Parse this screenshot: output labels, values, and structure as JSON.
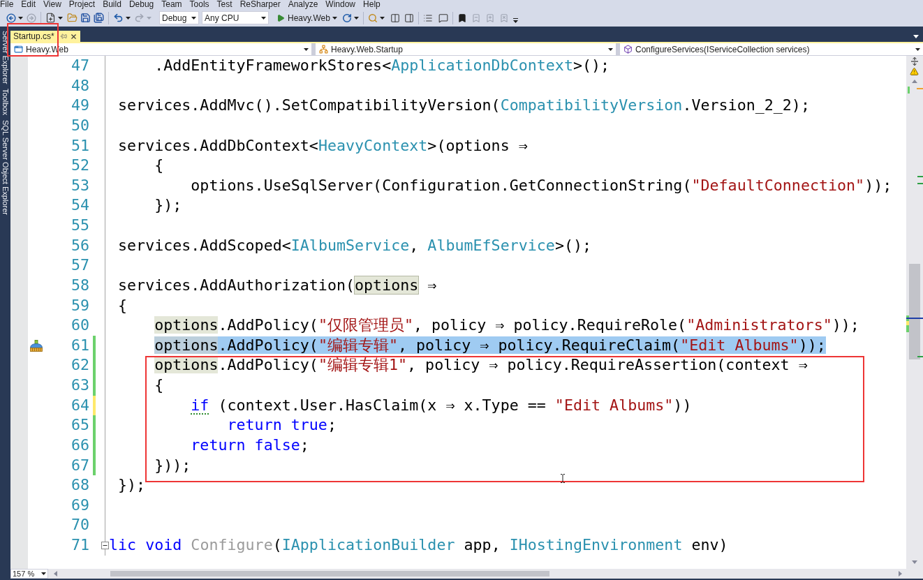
{
  "menu_bar": [
    "File",
    "Edit",
    "View",
    "Project",
    "Build",
    "Debug",
    "Team",
    "Tools",
    "Test",
    "ReSharper",
    "Analyze",
    "Window",
    "Help"
  ],
  "toolbar": {
    "configuration": "Debug",
    "platform": "Any CPU",
    "start_target": "Heavy.Web"
  },
  "side_tabs": [
    "Server Explorer",
    "Toolbox",
    "SQL Server Object Explorer"
  ],
  "document_tabs": [
    {
      "title": "Startup.cs*",
      "selected": true
    }
  ],
  "navigation_bar": [
    {
      "kind": "project",
      "text": "Heavy.Web"
    },
    {
      "kind": "class",
      "text": "Heavy.Web.Startup"
    },
    {
      "kind": "member",
      "text": "ConfigureServices(IServiceCollection services)"
    }
  ],
  "editor": {
    "lines": [
      {
        "number": "47",
        "selected": false,
        "tokens": [
          {
            "kind": "plain",
            "text": "     .AddEntityFrameworkStores<"
          },
          {
            "kind": "type",
            "text": "ApplicationDbContext"
          },
          {
            "kind": "plain",
            "text": ">();"
          }
        ]
      },
      {
        "number": "48",
        "selected": false
      },
      {
        "number": "49",
        "selected": false,
        "tokens": [
          {
            "kind": "plain",
            "text": " services.AddMvc().SetCompatibilityVersion("
          },
          {
            "kind": "type",
            "text": "CompatibilityVersion"
          },
          {
            "kind": "plain",
            "text": ".Version_2_2);"
          }
        ]
      },
      {
        "number": "50",
        "selected": false
      },
      {
        "number": "51",
        "selected": false,
        "tokens": [
          {
            "kind": "plain",
            "text": " services.AddDbContext<"
          },
          {
            "kind": "type",
            "text": "HeavyContext"
          },
          {
            "kind": "plain",
            "text": ">(options ⇒"
          }
        ]
      },
      {
        "number": "52",
        "selected": false,
        "tokens": [
          {
            "kind": "plain",
            "text": "     {"
          }
        ]
      },
      {
        "number": "53",
        "selected": false,
        "tokens": [
          {
            "kind": "plain",
            "text": "         options.UseSqlServer(Configuration.GetConnectionString("
          },
          {
            "kind": "string",
            "text": "\"DefaultConnection\""
          },
          {
            "kind": "plain",
            "text": "));"
          }
        ]
      },
      {
        "number": "54",
        "selected": false,
        "tokens": [
          {
            "kind": "plain",
            "text": "     });"
          }
        ]
      },
      {
        "number": "55",
        "selected": false
      },
      {
        "number": "56",
        "selected": false,
        "tokens": [
          {
            "kind": "plain",
            "text": " services.AddScoped<"
          },
          {
            "kind": "type",
            "text": "IAlbumService"
          },
          {
            "kind": "plain",
            "text": ", "
          },
          {
            "kind": "type",
            "text": "AlbumEfService"
          },
          {
            "kind": "plain",
            "text": ">();"
          }
        ]
      },
      {
        "number": "57",
        "selected": false
      },
      {
        "number": "58",
        "selected": false,
        "tokens": [
          {
            "kind": "plain",
            "text": " services.AddAuthorization("
          },
          {
            "kind": "definition",
            "text": "options"
          },
          {
            "kind": "plain",
            "text": " ⇒"
          }
        ]
      },
      {
        "number": "59",
        "selected": false,
        "tokens": [
          {
            "kind": "plain",
            "text": " {"
          }
        ]
      },
      {
        "number": "60",
        "selected": false,
        "tokens": [
          {
            "kind": "reference",
            "text": "     options"
          },
          {
            "kind": "plain",
            "text": ".AddPolicy("
          },
          {
            "kind": "string",
            "text": "\"仅限管理员\""
          },
          {
            "kind": "plain",
            "text": ", policy ⇒ policy.RequireRole("
          },
          {
            "kind": "string",
            "text": "\"Administrators\""
          },
          {
            "kind": "plain",
            "text": "));"
          }
        ]
      },
      {
        "number": "61",
        "selected": true,
        "change": {
          "color": "#6cd16c"
        },
        "margin_icon": {
          "kind": "cleanup"
        },
        "tokens": [
          {
            "kind": "reference",
            "text": "     options"
          },
          {
            "kind": "plain",
            "text": ".AddPolicy("
          },
          {
            "kind": "string",
            "text": "\"编辑专辑\""
          },
          {
            "kind": "plain",
            "text": ", policy ⇒ policy.RequireClaim("
          },
          {
            "kind": "string",
            "text": "\"Edit Albums\""
          },
          {
            "kind": "plain",
            "text": "));"
          }
        ]
      },
      {
        "number": "62",
        "selected": false,
        "change": {
          "color": "#6cd16c"
        },
        "tokens": [
          {
            "kind": "reference",
            "text": "     options"
          },
          {
            "kind": "plain",
            "text": ".AddPolicy("
          },
          {
            "kind": "string",
            "text": "\"编辑专辑1\""
          },
          {
            "kind": "plain",
            "text": ", policy ⇒ policy.RequireAssertion(context ⇒"
          }
        ]
      },
      {
        "number": "63",
        "selected": false,
        "change": {
          "color": "#6cd16c"
        },
        "tokens": [
          {
            "kind": "plain",
            "text": "     {"
          }
        ]
      },
      {
        "number": "64",
        "selected": false,
        "change": {
          "color": "#ffe96b"
        },
        "tokens": [
          {
            "kind": "suggestion",
            "text": "         if"
          },
          {
            "kind": "plain",
            "text": " (context.User.HasClaim(x ⇒ x.Type == "
          },
          {
            "kind": "string",
            "text": "\"Edit Albums\""
          },
          {
            "kind": "plain",
            "text": "))"
          }
        ]
      },
      {
        "number": "65",
        "selected": false,
        "change": {
          "color": "#6cd16c"
        },
        "tokens": [
          {
            "kind": "keyword",
            "text": "             return true"
          },
          {
            "kind": "plain",
            "text": ";"
          }
        ]
      },
      {
        "number": "66",
        "selected": false,
        "change": {
          "color": "#6cd16c"
        },
        "tokens": [
          {
            "kind": "keyword",
            "text": "         return false"
          },
          {
            "kind": "plain",
            "text": ";"
          }
        ]
      },
      {
        "number": "67",
        "selected": false,
        "change": {
          "color": "#6cd16c"
        },
        "tokens": [
          {
            "kind": "plain",
            "text": "     }));"
          }
        ]
      },
      {
        "number": "68",
        "selected": false,
        "tokens": [
          {
            "kind": "plain",
            "text": " });"
          }
        ]
      },
      {
        "number": "69",
        "selected": false
      },
      {
        "number": "70",
        "selected": false
      },
      {
        "number": "71",
        "selected": false,
        "outline": {
          "expanded": true
        },
        "tokens": [
          {
            "kind": "keyword",
            "text": "lic void"
          },
          {
            "kind": "dimmed",
            "text": " Configure"
          },
          {
            "kind": "plain",
            "text": "("
          },
          {
            "kind": "type",
            "text": "IApplicationBuilder"
          },
          {
            "kind": "plain",
            "text": " app, "
          },
          {
            "kind": "type",
            "text": "IHostingEnvironment"
          },
          {
            "kind": "plain",
            "text": " env)"
          }
        ]
      }
    ]
  },
  "zoom_level": "157 %"
}
